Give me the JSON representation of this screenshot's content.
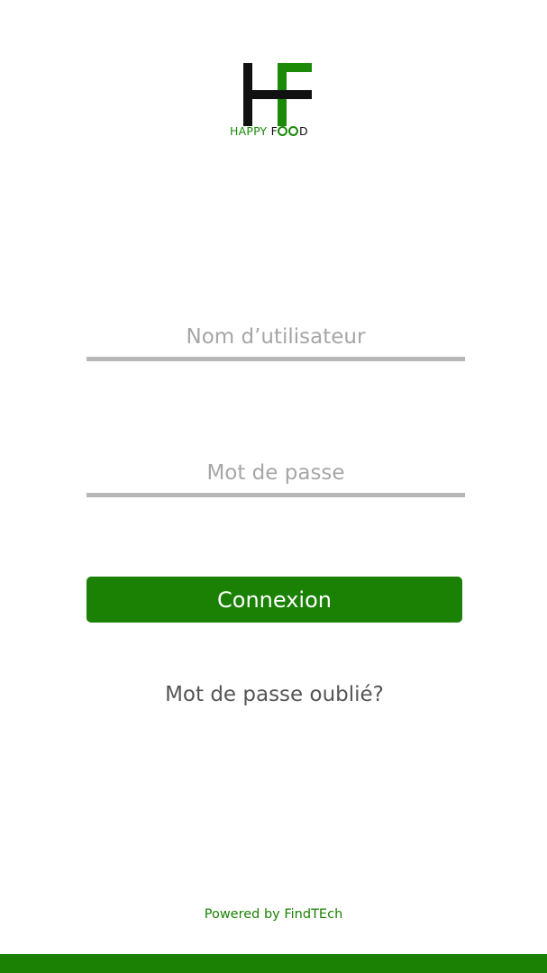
{
  "app": {
    "logo": {
      "monogram": "HF",
      "name_part1": "HAPPY",
      "name_part2_prefix": "F",
      "name_part2_suffix": "D",
      "icon": "hf-monogram-logo"
    }
  },
  "form": {
    "username": {
      "placeholder": "Nom d’utilisateur",
      "value": ""
    },
    "password": {
      "placeholder": "Mot de passe",
      "value": ""
    },
    "submit_label": "Connexion",
    "forgot_label": "Mot de passe oublié?"
  },
  "footer": {
    "powered_by": "Powered by FindTEch"
  },
  "colors": {
    "brand_green": "#1a8105",
    "underline_gray": "#b7b7b7",
    "placeholder_gray": "#a6a6a6",
    "text_gray": "#555555",
    "logo_black": "#111111"
  }
}
